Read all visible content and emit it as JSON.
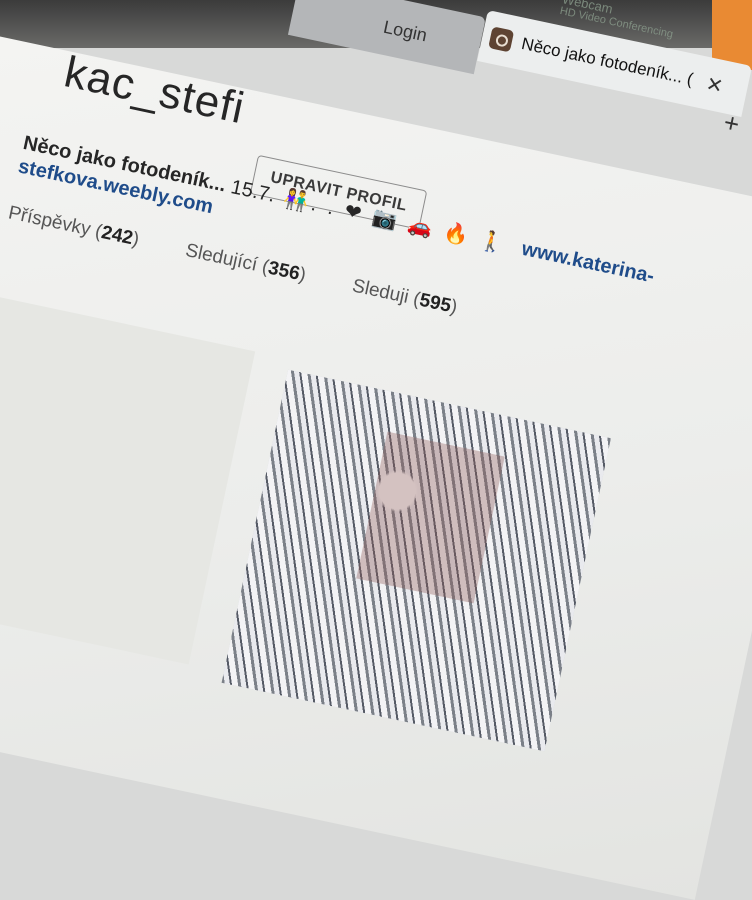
{
  "browser": {
    "tabs": [
      {
        "label": "Login"
      },
      {
        "label": "Něco jako fotodeník... (",
        "icon": "instagram-icon"
      }
    ],
    "close_glyph": "✕",
    "new_tab_glyph": "+",
    "webcam_overlay": {
      "title": "Webcam",
      "subtitle": "HD Video Conferencing"
    }
  },
  "profile": {
    "username": "kac_stefi",
    "edit_button": "UPRAVIT PROFIL",
    "bio_name": "Něco jako fotodeník...",
    "bio_date": "15.7.",
    "bio_emoji": "👫. . ❤ 📷 🚗 🔥 🚶",
    "bio_link_part1": "www.katerina-",
    "bio_link_part2": "stefkova.weebly.com",
    "stats": [
      {
        "label": "Příspěvky",
        "value": "242"
      },
      {
        "label": "Sledující",
        "value": "356"
      },
      {
        "label": "Sleduji",
        "value": "595"
      }
    ]
  }
}
